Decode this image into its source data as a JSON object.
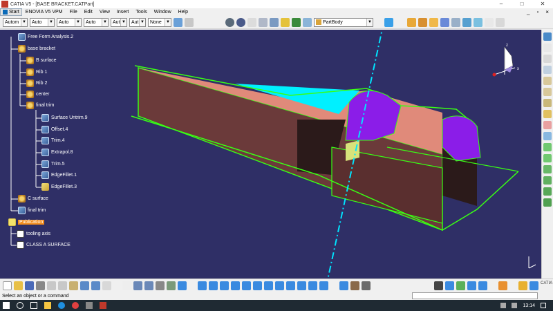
{
  "window": {
    "title": "CATIA V5 - [BASE BRACKET.CATPart]",
    "controls": [
      "–",
      "□",
      "✕"
    ]
  },
  "menu": {
    "start": "Start",
    "items": [
      "ENOVIA V5 VPM",
      "File",
      "Edit",
      "View",
      "Insert",
      "Tools",
      "Window",
      "Help"
    ],
    "right": [
      "_",
      "▫",
      "×"
    ]
  },
  "toolbar": {
    "combos": [
      "Autom",
      "Auto",
      "Auto",
      "Auto",
      "Aut",
      "Aut",
      "None"
    ],
    "partbody": "PartBody",
    "accent": "#1f6fbf"
  },
  "tree": {
    "nodes": [
      {
        "label": "Free Form Analysis.2",
        "icon": "analysis-icon"
      },
      {
        "label": "base bracket",
        "icon": "geometrical-set-icon"
      },
      {
        "label": "B surface",
        "icon": "geometrical-set-icon"
      },
      {
        "label": "Rib 1",
        "icon": "geometrical-set-icon"
      },
      {
        "label": "Rib 2",
        "icon": "geometrical-set-icon"
      },
      {
        "label": "center",
        "icon": "geometrical-set-icon"
      },
      {
        "label": "final trim",
        "icon": "geometrical-set-icon"
      },
      {
        "label": "Surface Untrim.9",
        "icon": "surface-feature-icon"
      },
      {
        "label": "Offset.4",
        "icon": "surface-feature-icon"
      },
      {
        "label": "Trim.4",
        "icon": "surface-feature-icon"
      },
      {
        "label": "Extrapol.8",
        "icon": "surface-feature-icon"
      },
      {
        "label": "Trim.5",
        "icon": "surface-feature-icon"
      },
      {
        "label": "EdgeFillet.1",
        "icon": "surface-feature-icon"
      },
      {
        "label": "EdgeFillet.3",
        "icon": "fillet-icon"
      },
      {
        "label": "C surface",
        "icon": "geometrical-set-icon"
      },
      {
        "label": "final trim",
        "icon": "surface-feature-icon"
      },
      {
        "label": "Publication",
        "icon": "publication-icon"
      },
      {
        "label": "tooling axis",
        "icon": "publication-item-icon"
      },
      {
        "label": "CLASS A SURFACE",
        "icon": "publication-item-icon"
      }
    ]
  },
  "viewport": {
    "background": "#2f2f66",
    "colors": {
      "edge": "#39ff14",
      "side": "#6b3a3a",
      "dark": "#2b1a1a",
      "highlight": "#00f0ff",
      "rib": "#8b1de8",
      "top": "#e08a7a",
      "axis": "#00e5ff"
    },
    "compass": {
      "z": "z",
      "x": "x"
    }
  },
  "status": {
    "message": "Select an object or a command"
  },
  "taskbar": {
    "time": "13:14"
  }
}
